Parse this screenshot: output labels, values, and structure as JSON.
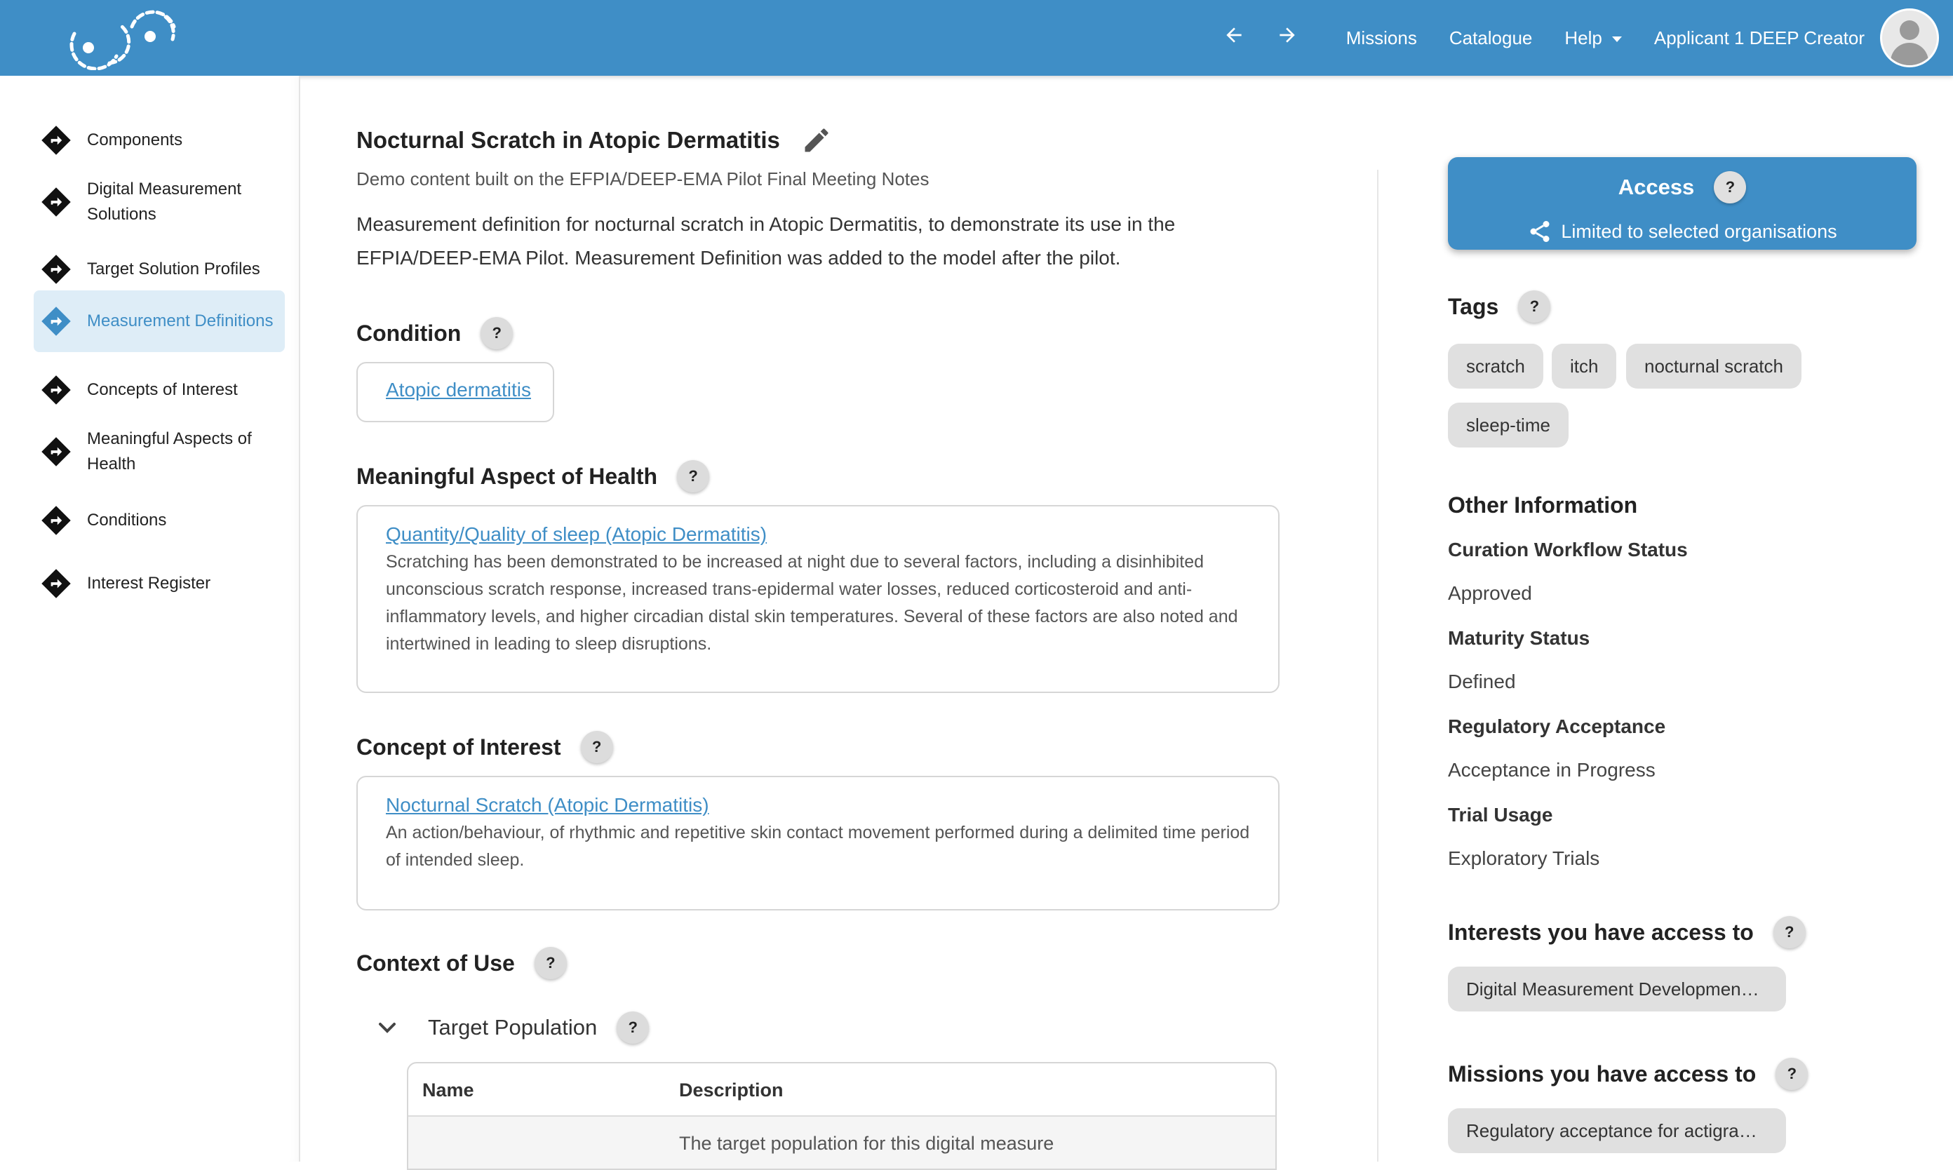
{
  "topbar": {
    "back_icon": "arrow-left-icon",
    "forward_icon": "arrow-right-icon",
    "nav": [
      "Missions",
      "Catalogue",
      "Help"
    ],
    "user": "Applicant 1 DEEP Creator",
    "colors": {
      "bar": "#3f8ec6"
    }
  },
  "sidebar": {
    "items": [
      {
        "label": "Components"
      },
      {
        "label": "Digital Measurement Solutions"
      },
      {
        "label": "Target Solution Profiles"
      },
      {
        "label": "Measurement Definitions"
      },
      {
        "label": "Concepts of Interest"
      },
      {
        "label": "Meaningful Aspects of Health"
      },
      {
        "label": "Conditions"
      },
      {
        "label": "Interest Register"
      }
    ]
  },
  "main": {
    "title": "Nocturnal Scratch in Atopic Dermatitis",
    "subtitle": "Demo content built on the EFPIA/DEEP-EMA Pilot Final Meeting Notes",
    "description": "Measurement definition for nocturnal scratch in Atopic Dermatitis, to demonstrate its use in the EFPIA/DEEP-EMA Pilot. Measurement Definition was added to the model after the pilot.",
    "help_symbol": "?",
    "condition": {
      "heading": "Condition",
      "link": "Atopic dermatitis"
    },
    "maoh": {
      "heading": "Meaningful Aspect of Health",
      "link": "Quantity/Quality of sleep (Atopic Dermatitis)",
      "text": "Scratching has been demonstrated to be increased at night due to several factors, including a disinhibited unconscious scratch response, increased trans-epidermal water losses, reduced corticosteroid and anti-inflammatory levels, and higher circadian distal skin temperatures. Several of these factors are also noted and intertwined in leading to sleep disruptions."
    },
    "coi": {
      "heading": "Concept of Interest",
      "link": "Nocturnal Scratch (Atopic Dermatitis)",
      "text": "An action/behaviour, of rhythmic and repetitive skin contact movement performed during a delimited time period of intended sleep."
    },
    "cou": {
      "heading": "Context of Use",
      "target_population": "Target Population",
      "table": {
        "headers": [
          "Name",
          "Description"
        ],
        "rows": [
          [
            "",
            "The target population for this digital measure"
          ]
        ]
      }
    }
  },
  "right": {
    "access": {
      "title": "Access",
      "subtitle": "Limited to selected organisations"
    },
    "tags": {
      "heading": "Tags",
      "items": [
        "scratch",
        "itch",
        "nocturnal scratch",
        "sleep-time"
      ]
    },
    "other": {
      "heading": "Other Information",
      "fields": [
        {
          "label": "Curation Workflow Status",
          "value": "Approved"
        },
        {
          "label": "Maturity Status",
          "value": "Defined"
        },
        {
          "label": "Regulatory Acceptance",
          "value": "Acceptance in Progress"
        },
        {
          "label": "Trial Usage",
          "value": "Exploratory Trials"
        }
      ]
    },
    "interests": {
      "heading": "Interests you have access to",
      "chip": "Digital Measurement Developmen…"
    },
    "missions": {
      "heading": "Missions you have access to",
      "chip": "Regulatory acceptance for actigra…"
    }
  }
}
